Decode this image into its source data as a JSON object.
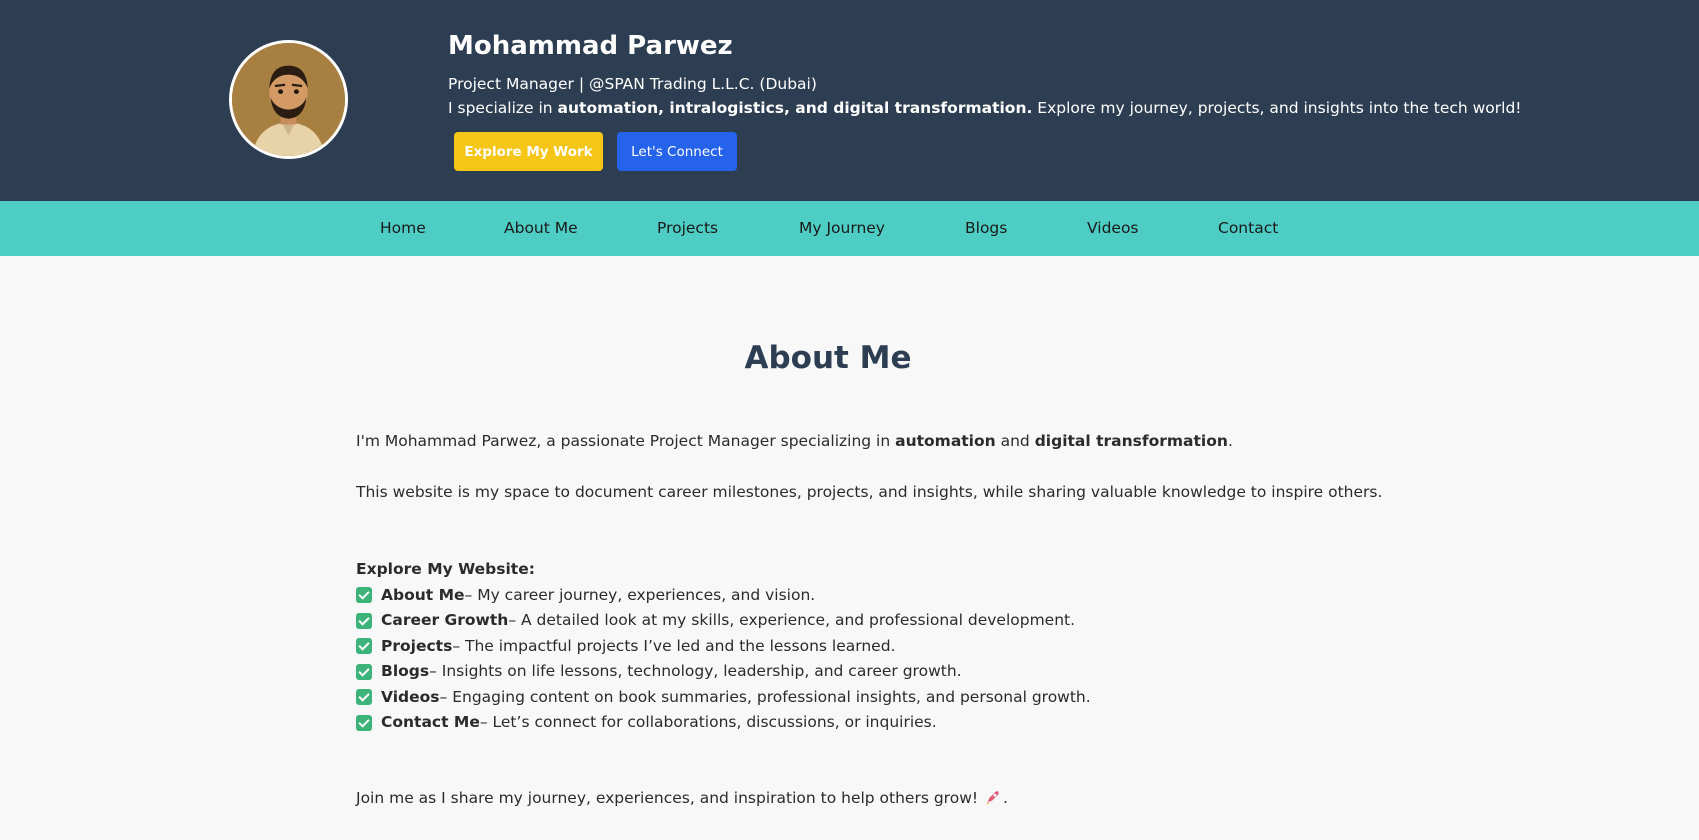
{
  "header": {
    "name": "Mohammad Parwez",
    "role": "Project Manager | @SPAN Trading L.L.C. (Dubai)",
    "desc_pre": "I specialize in ",
    "desc_bold": "automation, intralogistics, and digital transformation.",
    "desc_post": " Explore my journey, projects, and insights into the tech world!",
    "explore_button": "Explore My Work",
    "connect_button": "Let's Connect",
    "colors": {
      "bg": "#2e3e52",
      "explore": "#f5c518",
      "connect": "#2563eb"
    }
  },
  "nav": {
    "items": [
      "Home",
      "About Me",
      "Projects",
      "My Journey",
      "Blogs",
      "Videos",
      "Contact"
    ],
    "color": "#4ecdc4"
  },
  "about": {
    "title": "About Me",
    "p1_pre": "I'm Mohammad Parwez, a passionate Project Manager specializing in ",
    "p1_b1": "automation",
    "p1_mid": " and ",
    "p1_b2": "digital transformation",
    "p1_post": ".",
    "p2": "This website is my space to document career milestones, projects, and insights, while sharing valuable knowledge to inspire others.",
    "explore_heading": "Explore My Website:",
    "items": [
      {
        "bold": "About Me",
        "text": " – My career journey, experiences, and vision."
      },
      {
        "bold": "Career Growth",
        "text": " – A detailed look at my skills, experience, and professional development."
      },
      {
        "bold": "Projects",
        "text": " – The impactful projects I’ve led and the lessons learned."
      },
      {
        "bold": "Blogs",
        "text": " – Insights on life lessons, technology, leadership, and career growth."
      },
      {
        "bold": "Videos",
        "text": " – Engaging content on book summaries, professional insights, and personal growth."
      },
      {
        "bold": "Contact Me",
        "text": " – Let’s connect for collaborations, discussions, or inquiries."
      }
    ],
    "join_pre": "Join me as I share my journey, experiences, and inspiration to help others grow! ",
    "join_post": "."
  }
}
